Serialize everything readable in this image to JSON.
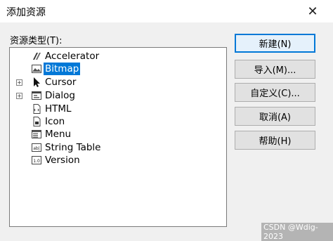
{
  "dialog": {
    "title": "添加资源"
  },
  "resource_list": {
    "label": "资源类型(T):",
    "items": [
      {
        "label": "Accelerator",
        "icon": "accelerator-icon",
        "expandable": false,
        "selected": false
      },
      {
        "label": "Bitmap",
        "icon": "bitmap-icon",
        "expandable": false,
        "selected": true
      },
      {
        "label": "Cursor",
        "icon": "cursor-icon",
        "expandable": true,
        "selected": false
      },
      {
        "label": "Dialog",
        "icon": "dialog-icon",
        "expandable": true,
        "selected": false
      },
      {
        "label": "HTML",
        "icon": "html-icon",
        "expandable": false,
        "selected": false
      },
      {
        "label": "Icon",
        "icon": "icon-resource-icon",
        "expandable": false,
        "selected": false
      },
      {
        "label": "Menu",
        "icon": "menu-icon",
        "expandable": false,
        "selected": false
      },
      {
        "label": "String Table",
        "icon": "string-table-icon",
        "expandable": false,
        "selected": false
      },
      {
        "label": "Version",
        "icon": "version-icon",
        "expandable": false,
        "selected": false
      }
    ],
    "expander_symbol": "+"
  },
  "buttons": {
    "new": "新建(N)",
    "import": "导入(M)...",
    "custom": "自定义(C)...",
    "cancel": "取消(A)",
    "help": "帮助(H)"
  },
  "watermark": "CSDN @Wdig-2023",
  "colors": {
    "selection": "#0078d7",
    "default_button_border": "#0078d7"
  }
}
